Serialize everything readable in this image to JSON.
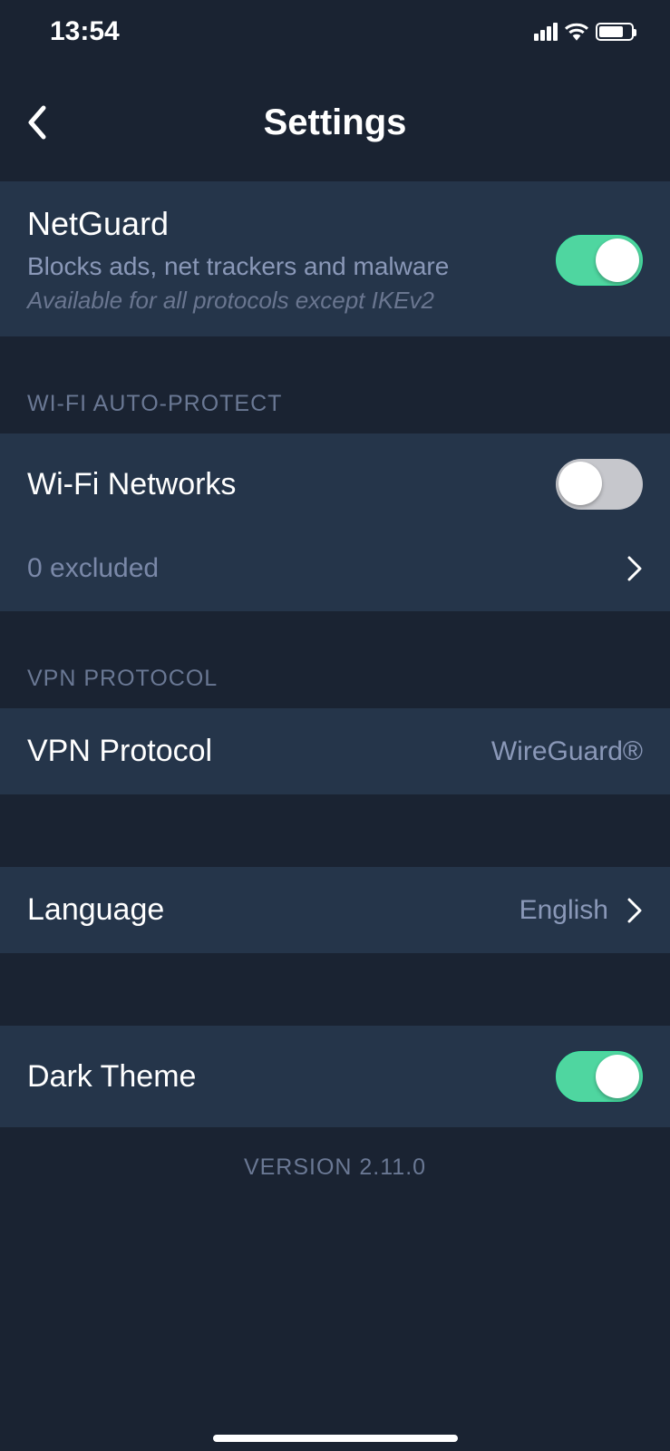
{
  "status": {
    "time": "13:54"
  },
  "header": {
    "title": "Settings"
  },
  "netguard": {
    "title": "NetGuard",
    "subtitle": "Blocks ads, net trackers and malware",
    "note": "Available for all protocols except IKEv2",
    "enabled": true
  },
  "wifi": {
    "section_label": "WI-FI AUTO-PROTECT",
    "title": "Wi-Fi Networks",
    "enabled": false,
    "excluded_text": "0 excluded"
  },
  "vpn": {
    "section_label": "VPN PROTOCOL",
    "title": "VPN Protocol",
    "value": "WireGuard®"
  },
  "language": {
    "title": "Language",
    "value": "English"
  },
  "dark_theme": {
    "title": "Dark Theme",
    "enabled": true
  },
  "version": {
    "text": "VERSION 2.11.0"
  }
}
